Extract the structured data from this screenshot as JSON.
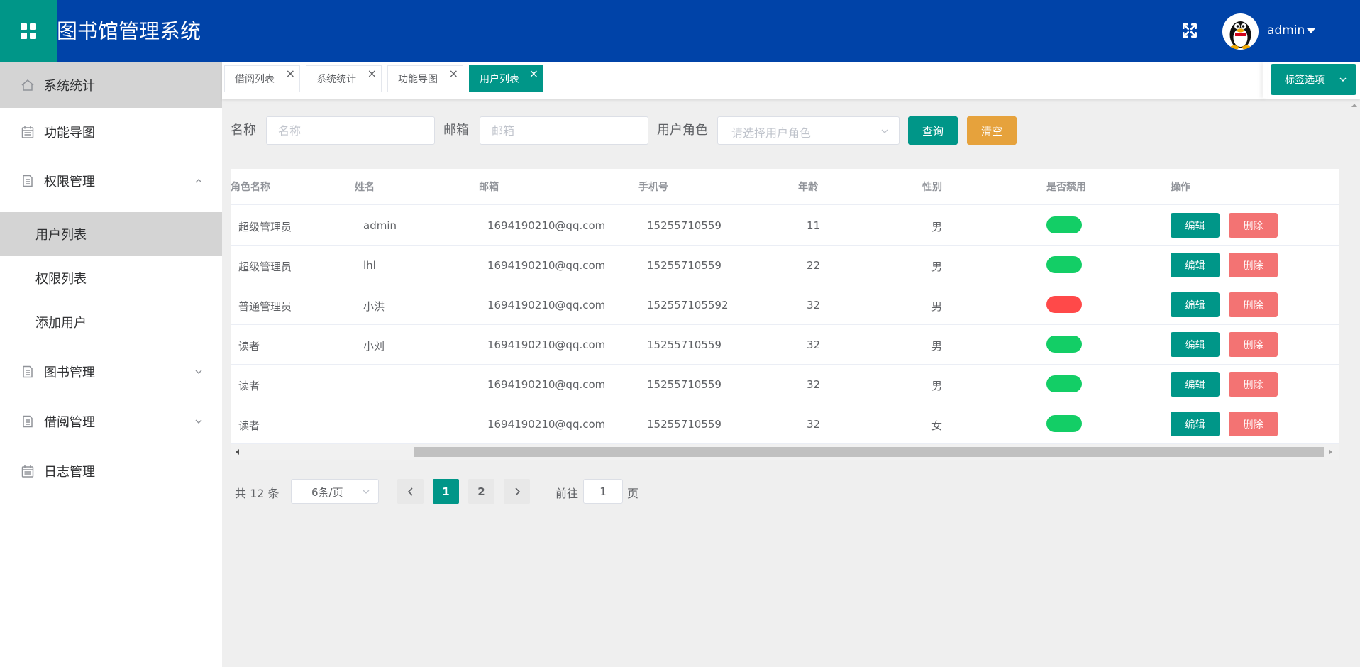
{
  "app": {
    "title": "图书馆管理系统",
    "user": "admin"
  },
  "sidebar": {
    "items": [
      {
        "label": "系统统计"
      },
      {
        "label": "功能导图"
      },
      {
        "label": "权限管理"
      },
      {
        "label": "用户列表"
      },
      {
        "label": "权限列表"
      },
      {
        "label": "添加用户"
      },
      {
        "label": "图书管理"
      },
      {
        "label": "借阅管理"
      },
      {
        "label": "日志管理"
      }
    ]
  },
  "tabs": [
    {
      "label": "借阅列表"
    },
    {
      "label": "系统统计"
    },
    {
      "label": "功能导图"
    },
    {
      "label": "用户列表"
    }
  ],
  "tab_options_label": "标签选项",
  "search": {
    "name_label": "名称",
    "name_placeholder": "名称",
    "email_label": "邮箱",
    "email_placeholder": "邮箱",
    "role_label": "用户角色",
    "role_placeholder": "请选择用户角色",
    "query_button": "查询",
    "clear_button": "清空"
  },
  "table": {
    "columns": [
      "角色名称",
      "姓名",
      "邮箱",
      "手机号",
      "年龄",
      "性别",
      "是否禁用",
      "操作"
    ],
    "rows": [
      {
        "role": "超级管理员",
        "name": "admin",
        "email": "1694190210@qq.com",
        "phone": "15255710559",
        "age": "11",
        "gender": "男",
        "enabled": true
      },
      {
        "role": "超级管理员",
        "name": "lhl",
        "email": "1694190210@qq.com",
        "phone": "15255710559",
        "age": "22",
        "gender": "男",
        "enabled": true
      },
      {
        "role": "普通管理员",
        "name": "小洪",
        "email": "1694190210@qq.com",
        "phone": "152557105592",
        "age": "32",
        "gender": "男",
        "enabled": false
      },
      {
        "role": "读者",
        "name": "小刘",
        "email": "1694190210@qq.com",
        "phone": "15255710559",
        "age": "32",
        "gender": "男",
        "enabled": true
      },
      {
        "role": "读者",
        "name": "",
        "email": "1694190210@qq.com",
        "phone": "15255710559",
        "age": "32",
        "gender": "男",
        "enabled": true
      },
      {
        "role": "读者",
        "name": "",
        "email": "1694190210@qq.com",
        "phone": "15255710559",
        "age": "32",
        "gender": "女",
        "enabled": true
      }
    ],
    "edit_label": "编辑",
    "delete_label": "删除"
  },
  "pagination": {
    "total": "共 12 条",
    "page_size": "6条/页",
    "pages": [
      "1",
      "2"
    ],
    "current_page": "1",
    "goto_label": "前往",
    "goto_value": "1",
    "page_suffix": "页"
  },
  "colors": {
    "header": "#0043a8",
    "accent": "#009688",
    "switch_on": "#13ce66",
    "switch_off": "#ff4949",
    "delete": "#f37373",
    "clear": "#e6a23c"
  },
  "icons": {
    "menu": "grid-icon",
    "fullscreen": "fullscreen-icon",
    "home": "home-icon",
    "calendar": "calendar-icon",
    "document": "document-icon"
  }
}
